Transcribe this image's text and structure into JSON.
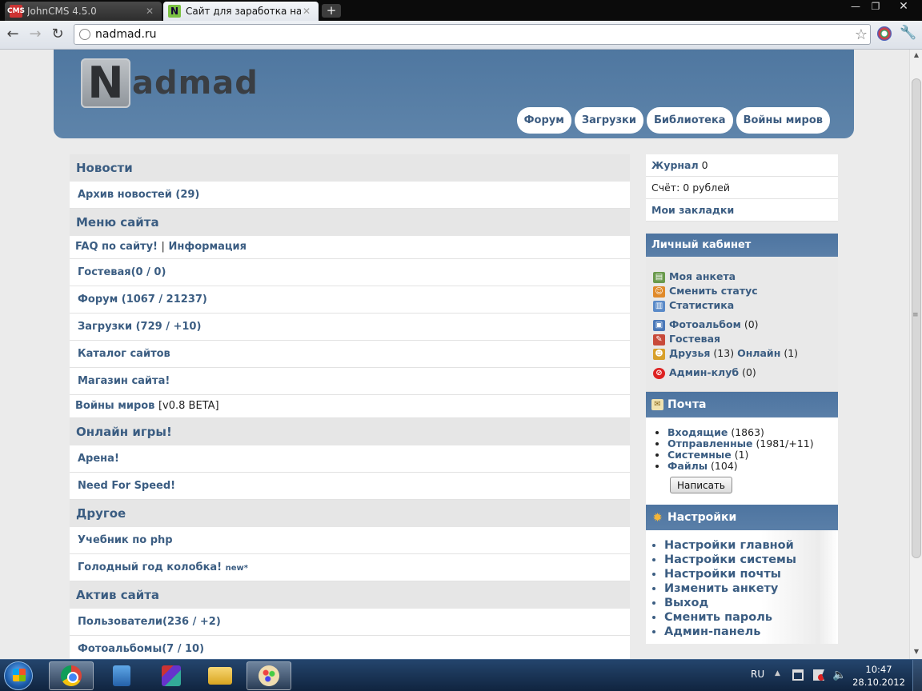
{
  "browser": {
    "tabs": [
      {
        "favicon": "CMS",
        "title": "JohnCMS 4.5.0"
      },
      {
        "favicon": "N",
        "title": "Сайт для заработка на пос"
      }
    ],
    "url": "nadmad.ru"
  },
  "site": {
    "logo_letter": "N",
    "logo_word": "admad",
    "nav": [
      "Форум",
      "Загрузки",
      "Библиотека",
      "Войны миров"
    ]
  },
  "main": {
    "news_title": "Новости",
    "news_archive": "Архив новостей (29)",
    "menu_title": "Меню сайта",
    "faq": "FAQ по сайту!",
    "faq_sep": "|",
    "info": "Информация",
    "guestbook": "Гостевая(0 / 0)",
    "forum": "Форум (1067 / 21237)",
    "downloads": "Загрузки (729 / +10)",
    "catalog": "Каталог сайтов",
    "shop": "Магазин сайта!",
    "wars": "Войны миров",
    "wars_ver": "[v0.8 BETA]",
    "games_title": "Онлайн игры!",
    "arena": "Арена!",
    "nfs": "Need For Speed!",
    "other_title": "Другое",
    "php": "Учебник по php",
    "kolobok": "Голодный год колобка!",
    "kolobok_tag": "new*",
    "active_title": "Актив сайта",
    "users": "Пользователи(236 / +2)",
    "photos": "Фотоальбомы(7 / 10)"
  },
  "sidebar": {
    "journal_label": "Журнал",
    "journal_count": "0",
    "balance": "Счёт: 0 рублей",
    "bookmarks": "Мои закладки",
    "cabinet_title": "Личный кабинет",
    "my_profile": "Моя анкета",
    "change_status": "Сменить статус",
    "statistics": "Статистика",
    "photoalbum": "Фотоальбом",
    "photoalbum_count": "(0)",
    "guestbook": "Гостевая",
    "friends": "Друзья",
    "friends_count": "(13)",
    "online": "Онлайн",
    "online_count": "(1)",
    "admin_club": "Админ-клуб",
    "admin_club_count": "(0)",
    "mail_title": "Почта",
    "inbox": "Входящие",
    "inbox_count": "(1863)",
    "sent": "Отправленные",
    "sent_count": "(1981/+11)",
    "system": "Системные",
    "system_count": "(1)",
    "files": "Файлы",
    "files_count": "(104)",
    "write_button": "Написать",
    "settings_title": "Настройки",
    "settings_items": [
      "Настройки главной",
      "Настройки системы",
      "Настройки почты",
      "Изменить анкету",
      "Выход",
      "Сменить пароль",
      "Админ-панель"
    ]
  },
  "taskbar": {
    "lang": "RU",
    "time": "10:47",
    "date": "28.10.2012"
  },
  "colors": {
    "link": "#3b5d82",
    "header_blue": "#5a7fa8"
  }
}
